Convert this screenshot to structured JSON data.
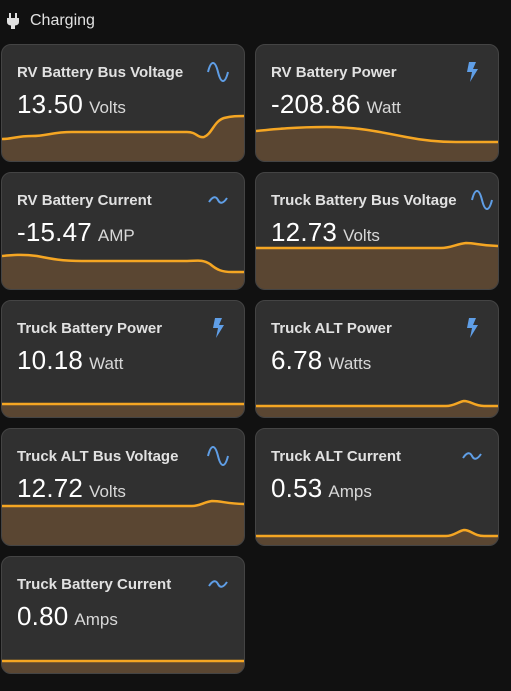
{
  "section": {
    "title": "Charging",
    "icon": "power-plug-icon"
  },
  "colors": {
    "accent_line": "#f5a623",
    "fill": "#5a4632",
    "icon_blue": "#5f9ee6",
    "card_bg": "#303030",
    "page_bg": "#111111"
  },
  "cards": [
    {
      "name": "RV Battery Bus Voltage",
      "value": "13.50",
      "unit": "Volts",
      "icon": "sine-wave-icon"
    },
    {
      "name": "RV Battery Power",
      "value": "-208.86",
      "unit": "Watt",
      "icon": "lightning-bolt-icon"
    },
    {
      "name": "RV Battery Current",
      "value": "-15.47",
      "unit": "AMP",
      "icon": "current-dc-icon"
    },
    {
      "name": "Truck Battery Bus Voltage",
      "value": "12.73",
      "unit": "Volts",
      "icon": "sine-wave-icon"
    },
    {
      "name": "Truck Battery Power",
      "value": "10.18",
      "unit": "Watt",
      "icon": "lightning-bolt-icon"
    },
    {
      "name": "Truck ALT Power",
      "value": "6.78",
      "unit": "Watts",
      "icon": "lightning-bolt-icon"
    },
    {
      "name": "Truck ALT Bus Voltage",
      "value": "12.72",
      "unit": "Volts",
      "icon": "sine-wave-icon"
    },
    {
      "name": "Truck ALT Current",
      "value": "0.53",
      "unit": "Amps",
      "icon": "current-dc-icon"
    },
    {
      "name": "Truck Battery Current",
      "value": "0.80",
      "unit": "Amps",
      "icon": "current-dc-icon"
    }
  ]
}
